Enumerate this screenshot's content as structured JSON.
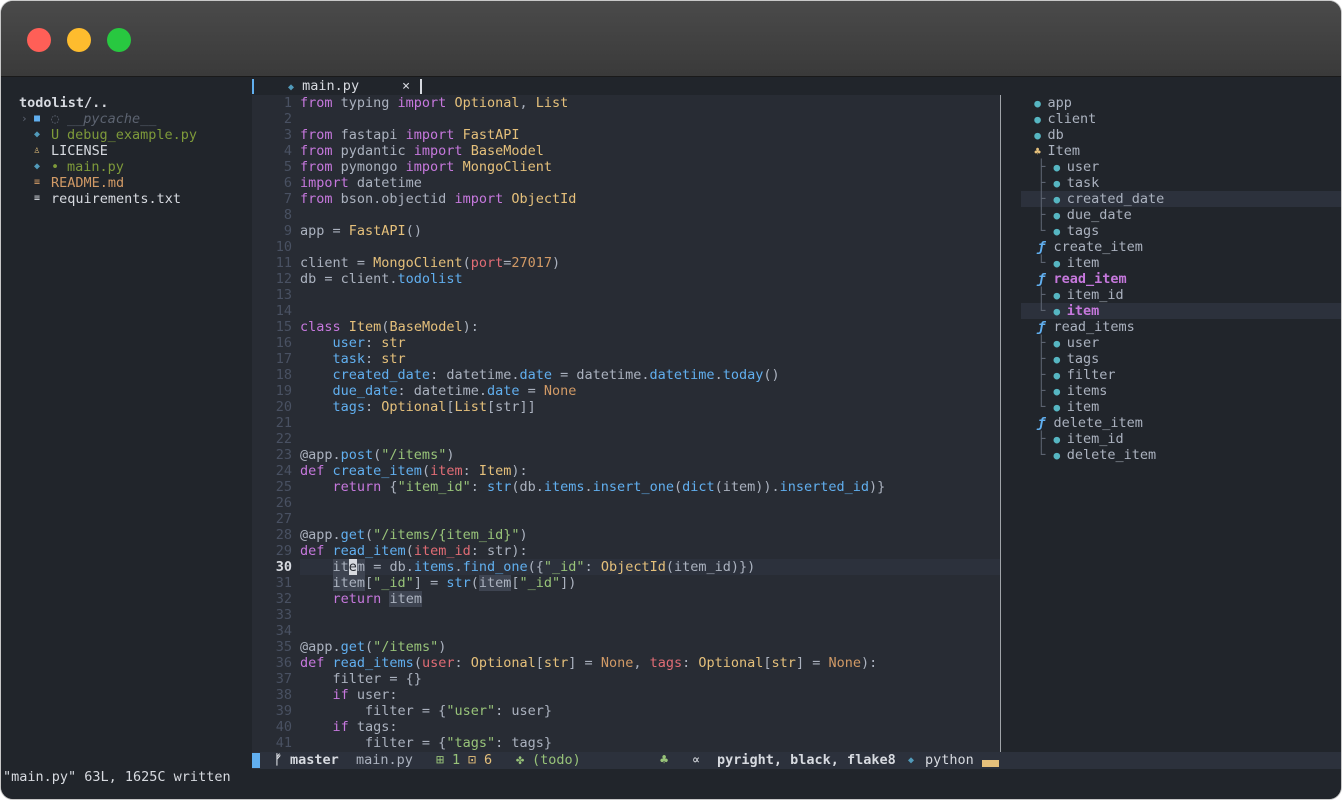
{
  "window": {
    "traffic_lights": [
      "close",
      "minimize",
      "maximize"
    ]
  },
  "tree": {
    "root": "todolist/..",
    "items": [
      {
        "prefix": "›",
        "icon": "folder-icon",
        "mark": "◌",
        "label": "__pycache__",
        "color": "#5c6370"
      },
      {
        "prefix": "",
        "icon": "python-icon",
        "mark": "U",
        "label": "debug_example.py",
        "color": "#7e9a3a"
      },
      {
        "prefix": "",
        "icon": "license-icon",
        "mark": "",
        "label": "LICENSE",
        "color": "#d7dae0"
      },
      {
        "prefix": "",
        "icon": "python-icon",
        "mark": "•",
        "label": "main.py",
        "color": "#7e9a3a"
      },
      {
        "prefix": "",
        "icon": "markdown-icon",
        "mark": "",
        "label": "README.md",
        "color": "#d19a66"
      },
      {
        "prefix": "",
        "icon": "text-icon",
        "mark": "",
        "label": "requirements.txt",
        "color": "#d7dae0"
      }
    ]
  },
  "tab": {
    "label": "main.py",
    "close": "×"
  },
  "editor": {
    "current_line": 30,
    "line_numbers": [
      "1",
      "2",
      "3",
      "4",
      "5",
      "6",
      "7",
      "8",
      "9",
      "10",
      "11",
      "12",
      "13",
      "14",
      "15",
      "16",
      "17",
      "18",
      "19",
      "20",
      "21",
      "22",
      "23",
      "24",
      "25",
      "26",
      "27",
      "28",
      "29",
      "30",
      "31",
      "32",
      "33",
      "34",
      "35",
      "36",
      "37",
      "38",
      "39",
      "40",
      "41"
    ]
  },
  "outline": {
    "items": [
      {
        "indent": "",
        "icon": "●",
        "kind": "variable",
        "label": "app"
      },
      {
        "indent": "",
        "icon": "●",
        "kind": "variable",
        "label": "client"
      },
      {
        "indent": "",
        "icon": "●",
        "kind": "variable",
        "label": "db"
      },
      {
        "indent": "",
        "icon": "♣",
        "kind": "class",
        "label": "Item"
      },
      {
        "indent": "├ ",
        "icon": "●",
        "kind": "variable",
        "label": "user"
      },
      {
        "indent": "├ ",
        "icon": "●",
        "kind": "variable",
        "label": "task"
      },
      {
        "indent": "├ ",
        "icon": "●",
        "kind": "variable",
        "label": "created_date",
        "selected": true
      },
      {
        "indent": "├ ",
        "icon": "●",
        "kind": "variable",
        "label": "due_date"
      },
      {
        "indent": "└ ",
        "icon": "●",
        "kind": "variable",
        "label": "tags"
      },
      {
        "indent": "",
        "icon": "ƒ",
        "kind": "function",
        "label": "create_item"
      },
      {
        "indent": "└ ",
        "icon": "●",
        "kind": "variable",
        "label": "item"
      },
      {
        "indent": "",
        "icon": "ƒ",
        "kind": "function",
        "label": "read_item",
        "bold": true
      },
      {
        "indent": "├ ",
        "icon": "●",
        "kind": "variable",
        "label": "item_id"
      },
      {
        "indent": "└ ",
        "icon": "●",
        "kind": "variable",
        "label": "item",
        "bold": true,
        "selected": true
      },
      {
        "indent": "",
        "icon": "ƒ",
        "kind": "function",
        "label": "read_items"
      },
      {
        "indent": "├ ",
        "icon": "●",
        "kind": "variable",
        "label": "user"
      },
      {
        "indent": "├ ",
        "icon": "●",
        "kind": "variable",
        "label": "tags"
      },
      {
        "indent": "├ ",
        "icon": "●",
        "kind": "variable",
        "label": "filter"
      },
      {
        "indent": "├ ",
        "icon": "●",
        "kind": "variable",
        "label": "items"
      },
      {
        "indent": "└ ",
        "icon": "●",
        "kind": "variable",
        "label": "item"
      },
      {
        "indent": "",
        "icon": "ƒ",
        "kind": "function",
        "label": "delete_item"
      },
      {
        "indent": "├ ",
        "icon": "●",
        "kind": "variable",
        "label": "item_id"
      },
      {
        "indent": "└ ",
        "icon": "●",
        "kind": "variable",
        "label": "delete_item"
      }
    ]
  },
  "status": {
    "branch_icon": "ᚠ",
    "branch": "master",
    "file": "main.py",
    "added": "1",
    "changed": "6",
    "todo": "(todo)",
    "lsp": "pyright, black, flake8",
    "filetype": "python"
  },
  "cmdline": "\"main.py\" 63L, 1625C written",
  "colors": {
    "background": "#282c34",
    "sidebar": "#21252b",
    "keyword": "#c678dd",
    "type": "#e5c07b",
    "string": "#98c379",
    "function": "#61afef"
  }
}
